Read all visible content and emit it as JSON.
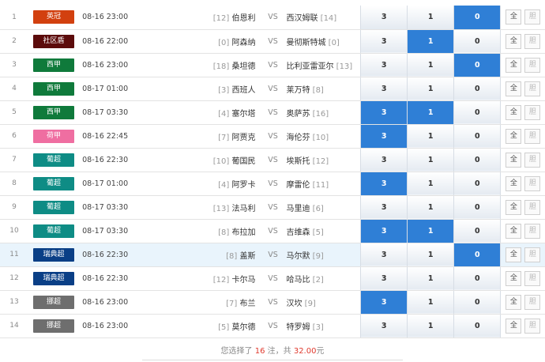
{
  "rows": [
    {
      "num": "1",
      "league": "英冠",
      "league_color": "#d2400f",
      "time": "08-16 23:00",
      "home_rank": "[12]",
      "home": "伯恩利",
      "vs": "VS",
      "away": "西汉姆联",
      "away_rank": "[14]",
      "win": "3",
      "draw": "1",
      "lose": "0",
      "selected": [
        "lose"
      ],
      "btn_all": "全",
      "btn_dan": "胆"
    },
    {
      "num": "2",
      "league": "社区盾",
      "league_color": "#5c0b0b",
      "time": "08-16 22:00",
      "home_rank": "[0]",
      "home": "阿森纳",
      "vs": "VS",
      "away": "曼彻斯特城",
      "away_rank": "[0]",
      "win": "3",
      "draw": "1",
      "lose": "0",
      "selected": [
        "draw"
      ],
      "btn_all": "全",
      "btn_dan": "胆"
    },
    {
      "num": "3",
      "league": "西甲",
      "league_color": "#0f7a3b",
      "time": "08-16 23:00",
      "home_rank": "[18]",
      "home": "桑坦德",
      "vs": "VS",
      "away": "比利亚雷亚尔",
      "away_rank": "[13]",
      "win": "3",
      "draw": "1",
      "lose": "0",
      "selected": [
        "lose"
      ],
      "btn_all": "全",
      "btn_dan": "胆"
    },
    {
      "num": "4",
      "league": "西甲",
      "league_color": "#0f7a3b",
      "time": "08-17 01:00",
      "home_rank": "[3]",
      "home": "西班人",
      "vs": "VS",
      "away": "莱万特",
      "away_rank": "[8]",
      "win": "3",
      "draw": "1",
      "lose": "0",
      "selected": [],
      "btn_all": "全",
      "btn_dan": "胆"
    },
    {
      "num": "5",
      "league": "西甲",
      "league_color": "#0f7a3b",
      "time": "08-17 03:30",
      "home_rank": "[4]",
      "home": "塞尔塔",
      "vs": "VS",
      "away": "奥萨苏",
      "away_rank": "[16]",
      "win": "3",
      "draw": "1",
      "lose": "0",
      "selected": [
        "win",
        "draw"
      ],
      "btn_all": "全",
      "btn_dan": "胆"
    },
    {
      "num": "6",
      "league": "荷甲",
      "league_color": "#ef6ea1",
      "time": "08-16 22:45",
      "home_rank": "[7]",
      "home": "阿贾克",
      "vs": "VS",
      "away": "海伦芬",
      "away_rank": "[10]",
      "win": "3",
      "draw": "1",
      "lose": "0",
      "selected": [
        "win"
      ],
      "btn_all": "全",
      "btn_dan": "胆"
    },
    {
      "num": "7",
      "league": "葡超",
      "league_color": "#0e8c85",
      "time": "08-16 22:30",
      "home_rank": "[10]",
      "home": "葡国民",
      "vs": "VS",
      "away": "埃斯托",
      "away_rank": "[12]",
      "win": "3",
      "draw": "1",
      "lose": "0",
      "selected": [],
      "btn_all": "全",
      "btn_dan": "胆"
    },
    {
      "num": "8",
      "league": "葡超",
      "league_color": "#0e8c85",
      "time": "08-17 01:00",
      "home_rank": "[4]",
      "home": "阿罗卡",
      "vs": "VS",
      "away": "摩雷伦",
      "away_rank": "[11]",
      "win": "3",
      "draw": "1",
      "lose": "0",
      "selected": [
        "win"
      ],
      "btn_all": "全",
      "btn_dan": "胆"
    },
    {
      "num": "9",
      "league": "葡超",
      "league_color": "#0e8c85",
      "time": "08-17 03:30",
      "home_rank": "[13]",
      "home": "法马利",
      "vs": "VS",
      "away": "马里迪",
      "away_rank": "[6]",
      "win": "3",
      "draw": "1",
      "lose": "0",
      "selected": [],
      "btn_all": "全",
      "btn_dan": "胆"
    },
    {
      "num": "10",
      "league": "葡超",
      "league_color": "#0e8c85",
      "time": "08-17 03:30",
      "home_rank": "[8]",
      "home": "布拉加",
      "vs": "VS",
      "away": "吉维森",
      "away_rank": "[5]",
      "win": "3",
      "draw": "1",
      "lose": "0",
      "selected": [
        "win",
        "draw"
      ],
      "btn_all": "全",
      "btn_dan": "胆"
    },
    {
      "num": "11",
      "league": "瑞典超",
      "league_color": "#0a3f86",
      "time": "08-16 22:30",
      "home_rank": "[8]",
      "home": "盖斯",
      "vs": "VS",
      "away": "马尔默",
      "away_rank": "[9]",
      "win": "3",
      "draw": "1",
      "lose": "0",
      "selected": [
        "lose"
      ],
      "btn_all": "全",
      "btn_dan": "胆",
      "highlight": true
    },
    {
      "num": "12",
      "league": "瑞典超",
      "league_color": "#0a3f86",
      "time": "08-16 22:30",
      "home_rank": "[12]",
      "home": "卡尔马",
      "vs": "VS",
      "away": "哈马比",
      "away_rank": "[2]",
      "win": "3",
      "draw": "1",
      "lose": "0",
      "selected": [],
      "btn_all": "全",
      "btn_dan": "胆"
    },
    {
      "num": "13",
      "league": "挪超",
      "league_color": "#6e6e6e",
      "time": "08-16 23:00",
      "home_rank": "[7]",
      "home": "布兰",
      "vs": "VS",
      "away": "汉坎",
      "away_rank": "[9]",
      "win": "3",
      "draw": "1",
      "lose": "0",
      "selected": [
        "win"
      ],
      "btn_all": "全",
      "btn_dan": "胆"
    },
    {
      "num": "14",
      "league": "挪超",
      "league_color": "#6e6e6e",
      "time": "08-16 23:00",
      "home_rank": "[5]",
      "home": "莫尔德",
      "vs": "VS",
      "away": "特罗姆",
      "away_rank": "[3]",
      "win": "3",
      "draw": "1",
      "lose": "0",
      "selected": [],
      "btn_all": "全",
      "btn_dan": "胆"
    }
  ],
  "summary": {
    "prefix": "您选择了",
    "count": "16",
    "mid": "注，共",
    "amount": "32.00",
    "suffix": "元"
  },
  "colors": {
    "selected": "#2f7fd6",
    "highlight_row": "#e9f4fc",
    "accent_red": "#e03a2e"
  }
}
